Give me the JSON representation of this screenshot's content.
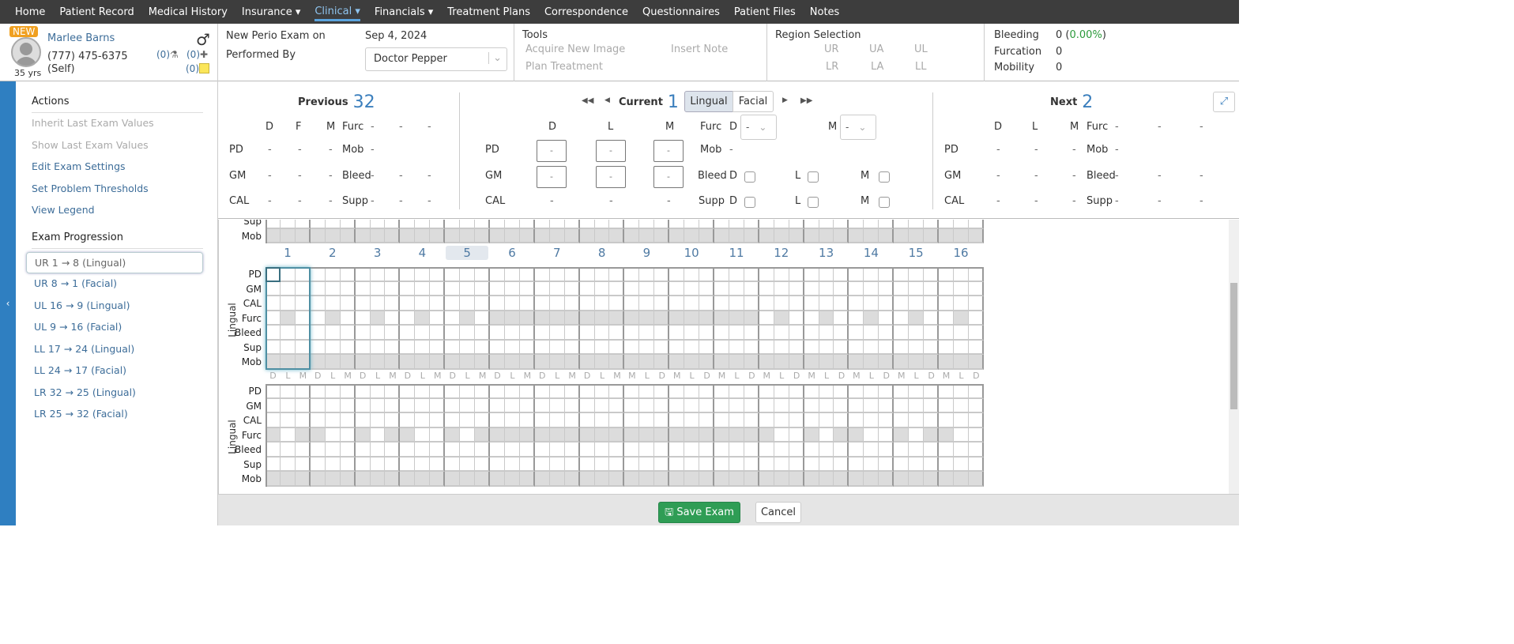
{
  "nav": [
    "Home",
    "Patient Record",
    "Medical History",
    "Insurance ▾",
    "Clinical ▾",
    "Financials ▾",
    "Treatment Plans",
    "Correspondence",
    "Questionnaires",
    "Patient Files",
    "Notes"
  ],
  "nav_active": 4,
  "patient": {
    "badge": "NEW",
    "name": "Marlee Barns",
    "phone": "(777) 475-6375",
    "relation": "(Self)",
    "age": "35 yrs",
    "gender_icon": "♂",
    "labs": "(0)",
    "meds": "(0)",
    "notes": "(0)"
  },
  "exam": {
    "title": "New Perio Exam on",
    "date": "Sep 4, 2024",
    "performed_label": "Performed By",
    "performer": "Doctor Pepper"
  },
  "tools": {
    "title": "Tools",
    "items": [
      "Acquire New Image",
      "Insert Note",
      "Plan Treatment"
    ]
  },
  "region": {
    "title": "Region Selection",
    "items": [
      "UR",
      "UA",
      "UL",
      "LR",
      "LA",
      "LL"
    ]
  },
  "stats": {
    "bleeding_label": "Bleeding",
    "bleeding_value": "0",
    "bleeding_pct": "0.00%",
    "furcation_label": "Furcation",
    "furcation_value": "0",
    "mobility_label": "Mobility",
    "mobility_value": "0"
  },
  "sidebar": {
    "actions_title": "Actions",
    "actions": [
      "Inherit Last Exam Values",
      "Show Last Exam Values",
      "Edit Exam Settings",
      "Set Problem Thresholds",
      "View Legend"
    ],
    "progression_title": "Exam Progression",
    "progression": [
      "UR 1 → 8 (Lingual)",
      "UR 8 → 1 (Facial)",
      "UL 16 → 9 (Lingual)",
      "UL 9 → 16 (Facial)",
      "LL 17 → 24 (Lingual)",
      "LL 24 → 17 (Facial)",
      "LR 32 → 25 (Lingual)",
      "LR 25 → 32 (Facial)"
    ]
  },
  "summary": {
    "previous": {
      "label": "Previous",
      "tooth": "32",
      "cols": [
        "D",
        "F",
        "M"
      ]
    },
    "current": {
      "label": "Current",
      "tooth": "1",
      "cols": [
        "D",
        "L",
        "M"
      ],
      "tabs": [
        "Lingual",
        "Facial"
      ]
    },
    "next": {
      "label": "Next",
      "tooth": "2",
      "cols": [
        "D",
        "L",
        "M"
      ]
    },
    "rows": [
      "PD",
      "GM",
      "CAL"
    ],
    "extra": [
      "Furc",
      "Mob",
      "Bleed",
      "Supp"
    ],
    "dash": "-"
  },
  "grid": {
    "rows": [
      "PD",
      "GM",
      "CAL",
      "Furc",
      "Bleed",
      "Sup",
      "Mob"
    ],
    "section_label": "Lingual",
    "teeth": [
      "1",
      "2",
      "3",
      "4",
      "5",
      "6",
      "7",
      "8",
      "9",
      "10",
      "11",
      "12",
      "13",
      "14",
      "15",
      "16"
    ],
    "surfaces_left": [
      "D",
      "L",
      "M"
    ],
    "surfaces_right": [
      "M",
      "L",
      "D"
    ],
    "partial_rows": [
      "Sup",
      "Mob"
    ]
  },
  "footer": {
    "save": "Save Exam",
    "cancel": "Cancel"
  }
}
